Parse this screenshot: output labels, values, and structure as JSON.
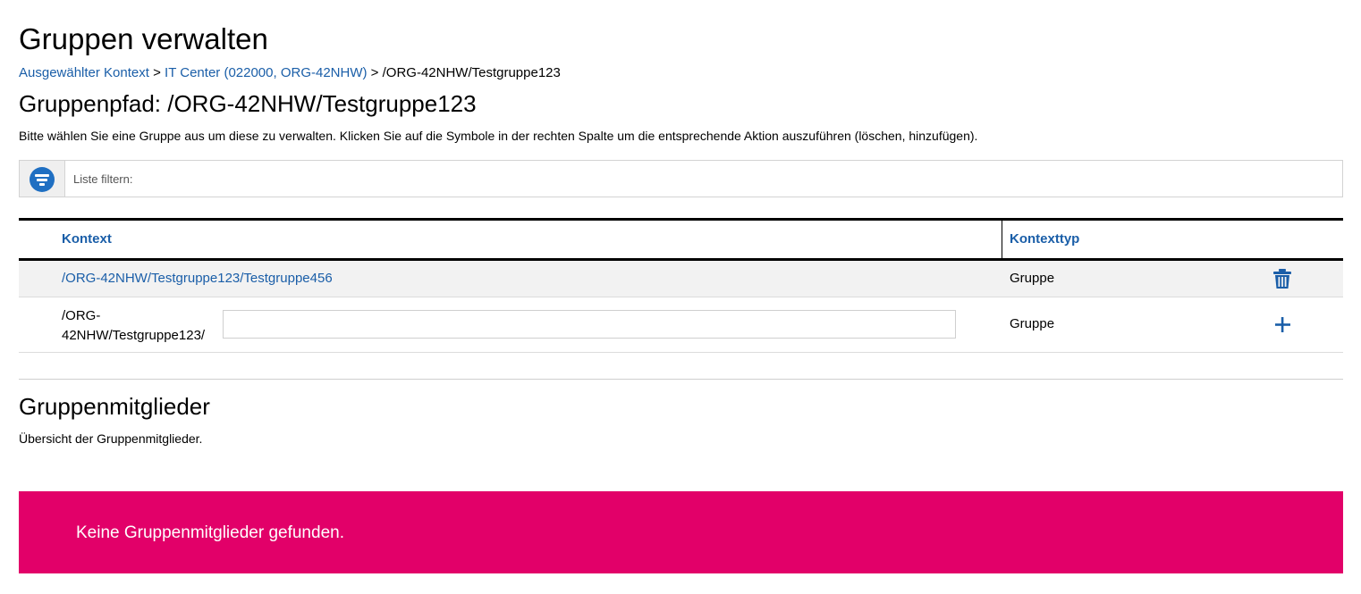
{
  "page": {
    "title": "Gruppen verwalten"
  },
  "breadcrumb": {
    "item1": "Ausgewählter Kontext",
    "sep1": ">",
    "item2": "IT Center (022000, ORG-42NHW)",
    "sep2": ">",
    "current": "/ORG-42NHW/Testgruppe123"
  },
  "group_path": {
    "heading": "Gruppenpfad: /ORG-42NHW/Testgruppe123",
    "description": "Bitte wählen Sie eine Gruppe aus um diese zu verwalten. Klicken Sie auf die Symbole in der rechten Spalte um die entsprechende Aktion auszuführen (löschen, hinzufügen)."
  },
  "filter": {
    "icon": "filter-icon",
    "placeholder": "Liste filtern:",
    "value": ""
  },
  "table": {
    "columns": [
      "Kontext",
      "Kontexttyp"
    ],
    "rows": [
      {
        "context": "/ORG-42NHW/Testgruppe123/Testgruppe456",
        "type": "Gruppe",
        "action_icon": "trash-icon"
      }
    ],
    "new_row": {
      "prefix_line1": "/ORG-",
      "prefix_line2": "42NHW/Testgruppe123/",
      "input_value": "",
      "type": "Gruppe",
      "action_icon": "plus-icon"
    }
  },
  "members": {
    "heading": "Gruppenmitglieder",
    "description": "Übersicht der Gruppenmitglieder.",
    "empty_message": "Keine Gruppenmitglieder gefunden."
  },
  "colors": {
    "link": "#1a5ea8",
    "accent_icon": "#1f6fc2",
    "alert_background": "#e20069",
    "alert_text": "#ffffff"
  }
}
